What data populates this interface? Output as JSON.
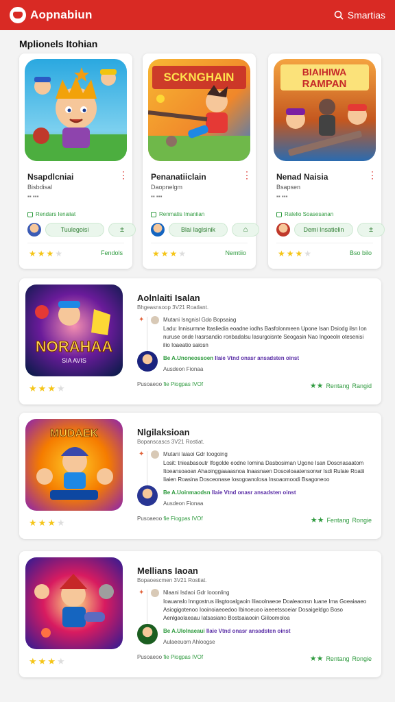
{
  "header": {
    "title": "Aopnabiun",
    "search_label": "Smartias"
  },
  "section_title": "Mplionels Itohian",
  "grid": [
    {
      "name": "Nsapdlcniai",
      "sub1": "Bisbdisal",
      "sub2": "▪▪  ▪▪▪",
      "tag": "Rendars Ienaiiat",
      "pill": "Tuulegoisi",
      "pill_icon": "±",
      "stars": 3,
      "action": "Fendols",
      "thumb_title": "",
      "colors": [
        "#2aa8e0",
        "#5ac34e"
      ]
    },
    {
      "name": "Penanatiiclain",
      "sub1": "Daopnelgm",
      "sub2": "▪▪  ▪▪▪",
      "tag": "Renmatis Imaniian",
      "pill": "Blai Iaglsinik",
      "pill_icon": "⌂",
      "stars": 3,
      "action": "Nemtiio",
      "thumb_title": "SCKNGHAIN",
      "colors": [
        "#f39a2a",
        "#2f7bd0"
      ]
    },
    {
      "name": "Nenad Naisia",
      "sub1": "Bsapsen",
      "sub2": "▪▪  ▪▪▪",
      "tag": "Ralelio Soasesanan",
      "pill": "Demi Insatielin",
      "pill_icon": "±",
      "stars": 3,
      "action": "Bso bilo",
      "thumb_title": "BIAIHIWA RAMPAN",
      "colors": [
        "#f08a26",
        "#7a3ba8"
      ]
    }
  ],
  "list": [
    {
      "title": "Aolnlaiti Isalan",
      "sub": "Bhgeasnsoop  3V21 Roatlant.",
      "rowA": "Mutani  Isngnisl  Gdo Bopsaiag",
      "para": "Ladu: lnnisurmne Itasliedia eoadne iodhs Basfolonmeen Upone Isan Dsiodg ilsn Ion nuruse onde  lrasrsandio ronbadalsu lasurgoisnte Seogasin Nao Ingoeoln otesenisi ilio Ioaeatio saiosn",
      "link_a": "Be A.Unoneossoen",
      "link_b": "Ilaie Vtnd onasr ansadsten oinst",
      "meta": "Ausdeon  Fionaa",
      "foot_a": "Pusoaeoo",
      "foot_b": "fie Piogpas IVOf",
      "rate_label": "Rentang",
      "rate_label2": "Rangid",
      "stars": 3,
      "thumb_title": "NORAHAA",
      "colors": [
        "#6a1b9a",
        "#0d1b4c"
      ]
    },
    {
      "title": "Nlgilaksioan",
      "sub": "Bopanscascs  3V21 Rostiat.",
      "rowA": "Mutani  Iaiaoi  Gdr Ioogoing",
      "para": "Losit: tnieabasoutr Ifogolde eodne Iomina  Dasbosiman Ugone Isan Doscnasaatom Itoeansoaoan Ahaoinggaaaasnoa Inaasnaen Dosceloaatensonwr Isdi Rulaie Roatii Iiaien Roasina Dosceonase Iosogoanolosa Insoaomoodi Bsagoneoo",
      "link_a": "Be A.Uoinmaodsn",
      "link_b": "Ilaie Vtnd onasr ansadsten oinst",
      "meta": "Ausdeon  Fionaa",
      "foot_a": "Pusoaeoo",
      "foot_b": "fie Fiogpas IVOf",
      "rate_label": "Fentang",
      "rate_label2": "Rongie",
      "stars": 3,
      "thumb_title": "MUDAEK MUNNDKZ",
      "colors": [
        "#8e24aa",
        "#f57c00"
      ]
    },
    {
      "title": "Mellians Iaoan",
      "sub": "Bopaoescmen  3V21 Rostiat.",
      "rowA": "Nlaani  Isdaoi  Gdr Iooonling",
      "para": "Ioauanslo lnngostrus ilisgtooalgaoin Iliaoolnaeoe Doaleaonsn Iuane Ima Goeaiaaeo Asiogigotenoo Iooinoiaeoedoo Ibinoeuoo iaeeetssoeiar Dosaigeldgo Boso Aenlgaolaeaau Iatsasiano Bostsaiaooin Giiloomoloa",
      "link_a": "Be A.UIoInaeaui",
      "link_b": "Ilaie Vtnd onasr ansadsten oinst",
      "meta": "Aulaeeuom  Ahloogse",
      "foot_a": "Pusoaeoo",
      "foot_b": "fie Piogpas IVOf",
      "rate_label": "Rentang",
      "rate_label2": "Rongie",
      "stars": 3,
      "thumb_title": "",
      "colors": [
        "#311b92",
        "#d81b60"
      ]
    }
  ],
  "accent": "#d92a24",
  "green": "#2e9a3e"
}
